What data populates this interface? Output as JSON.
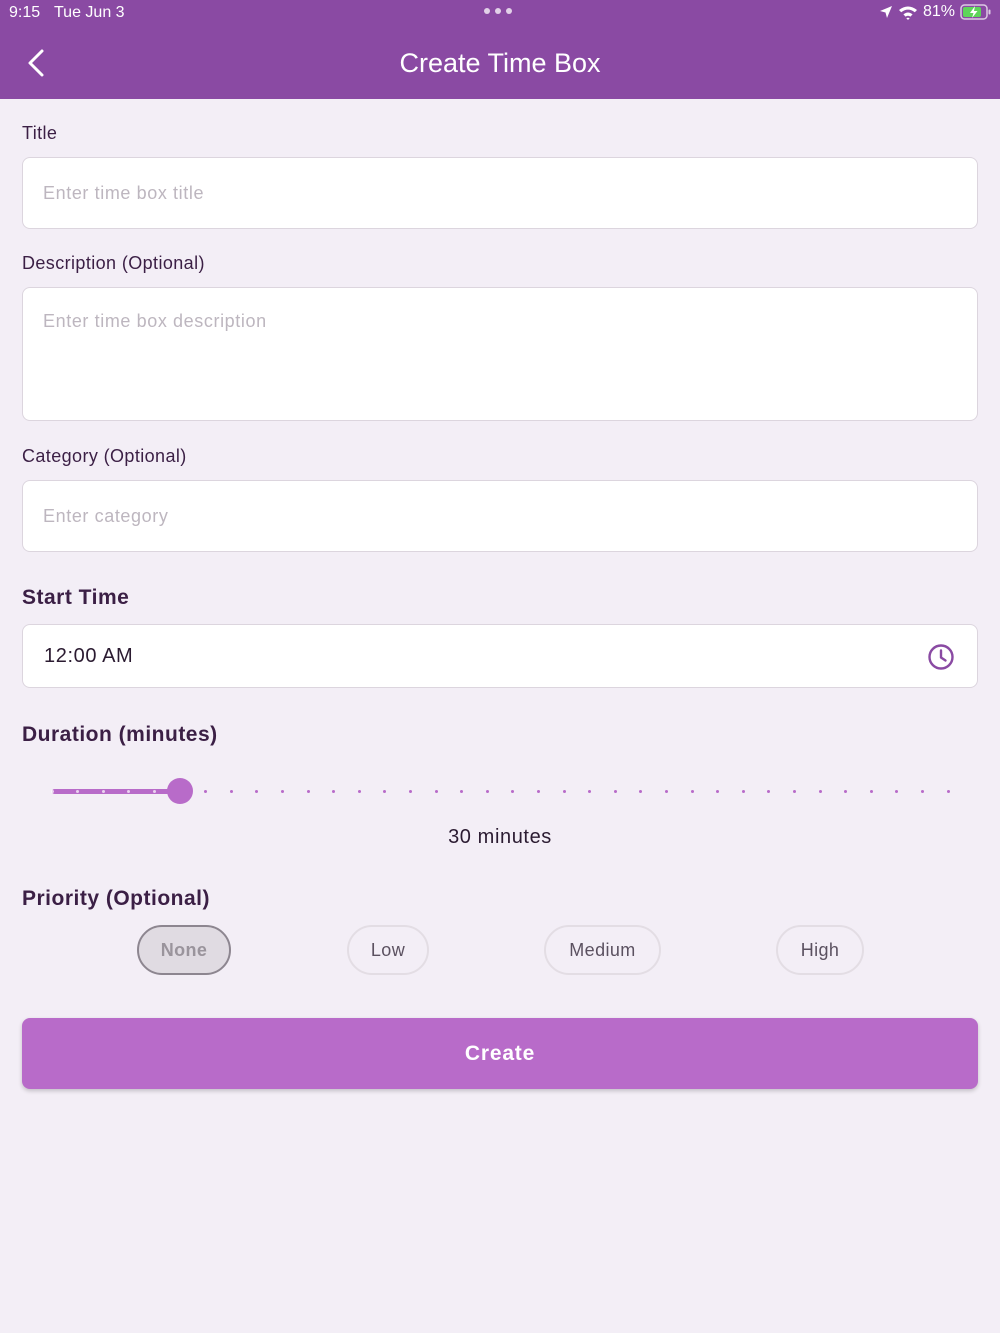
{
  "status_bar": {
    "time": "9:15",
    "date": "Tue Jun 3",
    "battery": "81%"
  },
  "header": {
    "title": "Create Time Box",
    "back_icon": "chevron-left-icon"
  },
  "form": {
    "title": {
      "label": "Title",
      "placeholder": "Enter time box title",
      "value": ""
    },
    "description": {
      "label": "Description (Optional)",
      "placeholder": "Enter time box description",
      "value": ""
    },
    "category": {
      "label": "Category (Optional)",
      "placeholder": "Enter category",
      "value": ""
    },
    "start_time": {
      "label": "Start Time",
      "value": "12:00 AM",
      "icon": "clock-icon"
    },
    "duration": {
      "label": "Duration (minutes)",
      "value": 30,
      "min": 5,
      "max": 180,
      "step": 5,
      "display": "30 minutes"
    },
    "priority": {
      "label": "Priority (Optional)",
      "options": [
        "None",
        "Low",
        "Medium",
        "High"
      ],
      "selected": "None"
    }
  },
  "actions": {
    "create_label": "Create"
  },
  "colors": {
    "header": "#8a4aa3",
    "accent": "#b86bc9",
    "background": "#f3eef6",
    "text": "#3b1f45"
  }
}
